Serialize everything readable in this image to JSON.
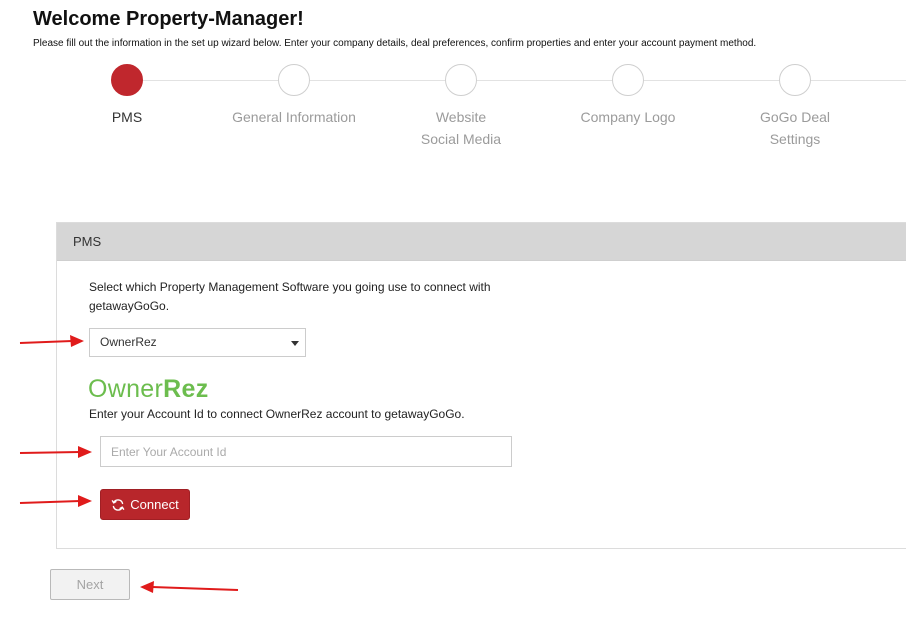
{
  "header": {
    "title": "Welcome Property-Manager!",
    "subtitle": "Please fill out the information in the set up wizard below. Enter your company details, deal preferences, confirm properties and enter your account payment method."
  },
  "wizard": {
    "active_step": 0,
    "steps": [
      {
        "line1": "PMS",
        "line2": ""
      },
      {
        "line1": "General Information",
        "line2": ""
      },
      {
        "line1": "Website",
        "line2": "Social Media"
      },
      {
        "line1": "Company Logo",
        "line2": ""
      },
      {
        "line1": "GoGo Deal",
        "line2": "Settings"
      }
    ]
  },
  "panel": {
    "header": "PMS",
    "instruction": "Select which Property Management Software you going use to connect with getawayGoGo.",
    "pms_select": {
      "selected": "OwnerRez"
    },
    "logo": {
      "part1": "Owner",
      "part2": "Rez"
    },
    "connect_text": "Enter your Account Id to connect OwnerRez account to getawayGoGo.",
    "account_input": {
      "value": "",
      "placeholder": "Enter Your Account Id"
    },
    "connect_button": {
      "label": "Connect",
      "icon": "refresh-icon"
    }
  },
  "footer": {
    "next_label": "Next"
  },
  "colors": {
    "accent": "#c0272d",
    "logo_green": "#6cbd4e",
    "panel_header_bg": "#d6d6d6",
    "annotation_arrow": "#e01b1b"
  }
}
